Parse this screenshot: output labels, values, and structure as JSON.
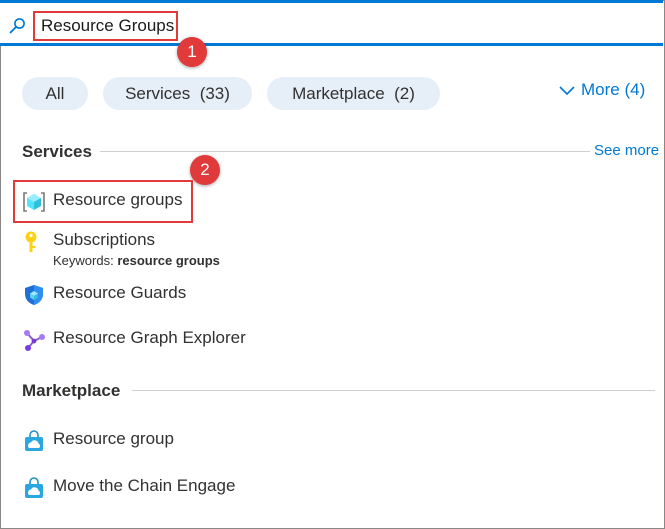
{
  "search": {
    "value": "Resource Groups"
  },
  "callouts": [
    "1",
    "2"
  ],
  "filters": [
    {
      "label": "All"
    },
    {
      "label": "Services  (33)"
    },
    {
      "label": "Marketplace  (2)"
    }
  ],
  "more_label": "More (4)",
  "services": {
    "title": "Services",
    "see_more": "See more",
    "items": [
      {
        "label": "Resource groups",
        "icon": "resource-groups-icon"
      },
      {
        "label": "Subscriptions",
        "icon": "key-icon",
        "keywords_prefix": "Keywords: ",
        "keywords": "resource groups"
      },
      {
        "label": "Resource Guards",
        "icon": "shield-icon"
      },
      {
        "label": "Resource Graph Explorer",
        "icon": "graph-explorer-icon"
      }
    ]
  },
  "marketplace": {
    "title": "Marketplace",
    "items": [
      {
        "label": "Resource group",
        "icon": "marketplace-bag-icon"
      },
      {
        "label": "Move the Chain Engage",
        "icon": "marketplace-bag-icon"
      }
    ]
  },
  "colors": {
    "accent": "#0078d4",
    "callout": "#e03a3a",
    "chip": "#e6eef7"
  }
}
